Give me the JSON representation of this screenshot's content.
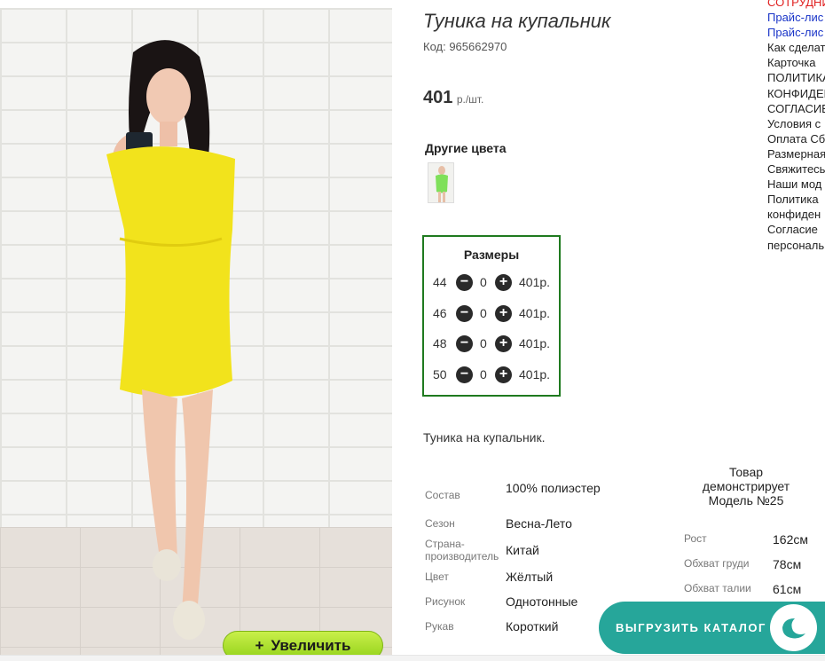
{
  "product": {
    "title": "Туника на купальник",
    "code": "Код: 965662970",
    "price": "401",
    "price_unit": "р./шт.",
    "zoom_label": "Увеличить",
    "other_colors_label": "Другие цвета",
    "description": "Туника на купальник."
  },
  "sizes": {
    "header": "Размеры",
    "rows": [
      {
        "size": "44",
        "qty": "0",
        "price": "401р."
      },
      {
        "size": "46",
        "qty": "0",
        "price": "401р."
      },
      {
        "size": "48",
        "qty": "0",
        "price": "401р."
      },
      {
        "size": "50",
        "qty": "0",
        "price": "401р."
      }
    ]
  },
  "properties": [
    {
      "key": "Состав",
      "value": "100% полиэстер"
    },
    {
      "key": "Сезон",
      "value": "Весна-Лето"
    },
    {
      "key": "Страна-производитель",
      "value": "Китай"
    },
    {
      "key": "Цвет",
      "value": "Жёлтый"
    },
    {
      "key": "Рисунок",
      "value": "Однотонные"
    },
    {
      "key": "Рукав",
      "value": "Короткий"
    }
  ],
  "model": {
    "title": "Товар демонстрирует Модель №25",
    "rows": [
      {
        "key": "Рост",
        "value": "162см"
      },
      {
        "key": "Обхват груди",
        "value": "78см"
      },
      {
        "key": "Обхват талии",
        "value": "61см"
      }
    ]
  },
  "side_links": [
    {
      "label": "СОТРУДНИ",
      "color": "red"
    },
    {
      "label": "Прайс-лис",
      "color": "blue"
    },
    {
      "label": "Прайс-лис",
      "color": "blue"
    },
    {
      "label": "Как сделат",
      "color": "dark"
    },
    {
      "label": "Карточка",
      "color": "dark"
    },
    {
      "label": "ПОЛИТИКА",
      "color": "dark"
    },
    {
      "label": "КОНФИДЕН",
      "color": "dark"
    },
    {
      "label": "СОГЛАСИЕ",
      "color": "dark"
    },
    {
      "label": "Условия с",
      "color": "dark"
    },
    {
      "label": "Оплата Сб",
      "color": "dark"
    },
    {
      "label": "Размерная",
      "color": "dark"
    },
    {
      "label": "Свяжитесь",
      "color": "dark"
    },
    {
      "label": "Наши мод",
      "color": "dark"
    },
    {
      "label": "Политика",
      "color": "dark"
    },
    {
      "label": "конфиден",
      "color": "dark"
    },
    {
      "label": "Согласие",
      "color": "dark"
    },
    {
      "label": "персональ",
      "color": "dark"
    }
  ],
  "export_button": "ВЫГРУЗИТЬ КАТАЛОГ",
  "colors": {
    "accent_green": "#1f7a1f",
    "zoom_button": "#a6dc28",
    "export_teal": "#26a69a",
    "dress_yellow": "#f2e31c"
  }
}
